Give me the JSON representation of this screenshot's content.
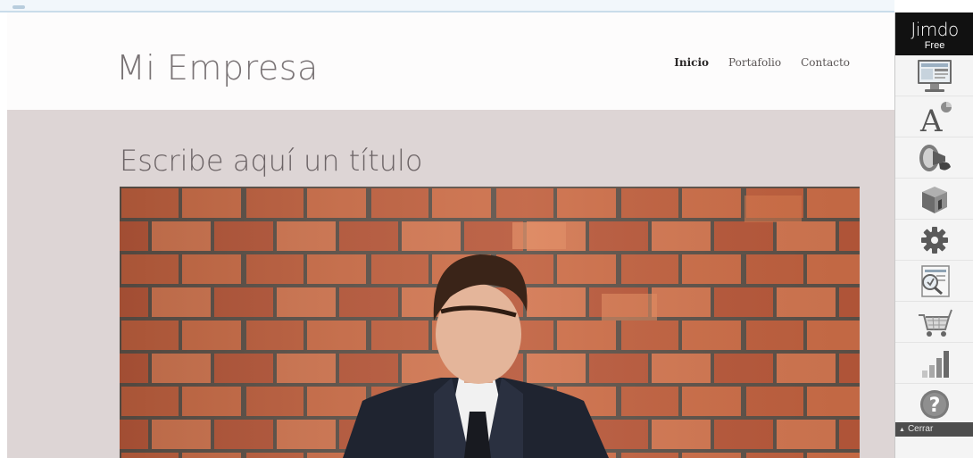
{
  "site": {
    "logo": "Mi Empresa",
    "nav": [
      {
        "label": "Inicio",
        "active": true
      },
      {
        "label": "Portafolio",
        "active": false
      },
      {
        "label": "Contacto",
        "active": false
      }
    ],
    "page_title": "Escribe aquí un título"
  },
  "jimdo_panel": {
    "brand": "Jimdo",
    "plan": "Free",
    "tools": [
      "layout-icon",
      "style-font-icon",
      "promote-megaphone-icon",
      "upgrade-box-icon",
      "settings-gear-icon",
      "seo-magnifier-icon",
      "shop-cart-icon",
      "statistics-bars-icon",
      "help-question-icon"
    ],
    "close_label": "Cerrar"
  },
  "colors": {
    "header_bg": "#fdfcfc",
    "content_bg": "#ddd5d5",
    "panel_brand_bg": "#111111",
    "close_bar_bg": "#4d4d4d"
  }
}
